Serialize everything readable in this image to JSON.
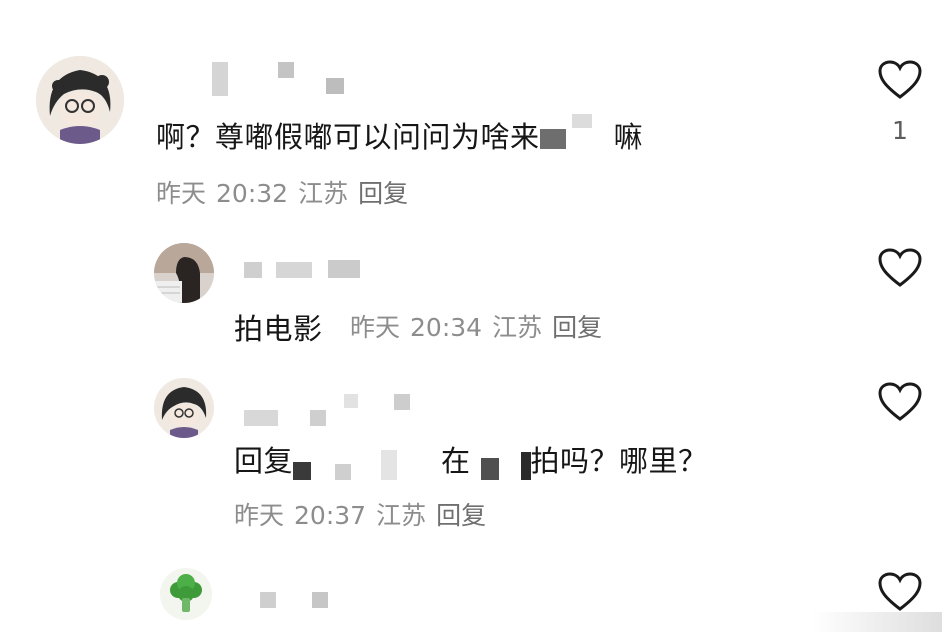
{
  "comments": [
    {
      "text_before": "啊？尊嘟假嘟可以问问为啥来",
      "text_after": "嘛",
      "date": "昨天",
      "time": "20:32",
      "location": "江苏",
      "reply_label": "回复",
      "likes": "1"
    },
    {
      "text": "拍电影",
      "date": "昨天",
      "time": "20:34",
      "location": "江苏",
      "reply_label": "回复"
    },
    {
      "reply_prefix": "回复",
      "text_mid": "在",
      "text_end": "拍吗？哪里？",
      "date": "昨天",
      "time": "20:37",
      "location": "江苏",
      "reply_label": "回复"
    }
  ],
  "icons": {
    "like": "heart-icon",
    "avatar_4": "broccoli-icon"
  },
  "colors": {
    "text": "#161616",
    "meta": "#8d8d8d",
    "heart_stroke": "#1a1a1a"
  }
}
